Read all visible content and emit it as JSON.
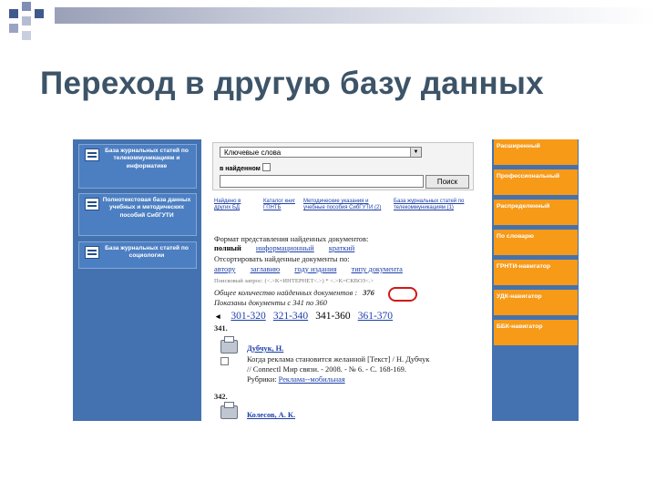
{
  "slide": {
    "title": "Переход в другую базу данных"
  },
  "colors": {
    "accent_blue": "#4472b0",
    "orange_button": "#f79a18",
    "link_blue": "#1c3fa8",
    "highlight_red": "#d21818",
    "title_color": "#3d5468"
  },
  "left_panel": {
    "items": [
      {
        "label": "База журнальных статей по телекоммуникациям и информатике",
        "icon": "database-icon"
      },
      {
        "label": "Полнотекстовая база данных учебных и методических пособий СибГУТИ",
        "icon": "database-icon"
      },
      {
        "label": "База журнальных статей по социологии",
        "icon": "database-icon"
      }
    ]
  },
  "search": {
    "field_select": "Ключевые слова",
    "in_found_label": "в найденном",
    "query_value": "",
    "button_label": "Поиск"
  },
  "navlinks": [
    {
      "label": "Найдено в других БД"
    },
    {
      "label": "Каталог книг ГПНТБ"
    },
    {
      "label": "Методические указания и учебные пособия СибГУТИ (2)"
    },
    {
      "label": "База журнальных статей по телекоммуникациям (1)"
    }
  ],
  "results": {
    "format_label": "Формат представления найденных документов:",
    "formats": [
      "полный",
      "информационный",
      "краткий"
    ],
    "sort_label": "Отсортировать найденные документы по:",
    "sort_options": [
      "автору",
      "заглавию",
      "году издания",
      "типу документа"
    ],
    "query_line": "Поисковый запрос: (<.>K=ИНТЕРНЕТ<.>) * <.>K=СКВОЗ<.>",
    "total_label": "Общее количество найденных документов :",
    "total_count": "376",
    "shown_label": "Показаны документы с 341 по 360",
    "pages": [
      "301-320",
      "321-340",
      "341-360",
      "361-370"
    ],
    "records": [
      {
        "number": "341.",
        "author": "Дубчук, Н.",
        "title": "Когда реклама становится желанной [Текст] / Н. Дубчук",
        "source": "// ConnectI Мир связи. - 2008. - № 6. - С. 168-169.",
        "rubric_label": "Рубрики:",
        "rubric": "Реклама--мобильная"
      },
      {
        "number": "342.",
        "author": "Колесов, А. К."
      }
    ]
  },
  "right_panel": {
    "buttons": [
      "Расширенный",
      "Профессиональный",
      "Распределенный",
      "По словарю",
      "ГРНТИ-навигатор",
      "УДК-навигатор",
      "ББК-навигатор"
    ]
  }
}
